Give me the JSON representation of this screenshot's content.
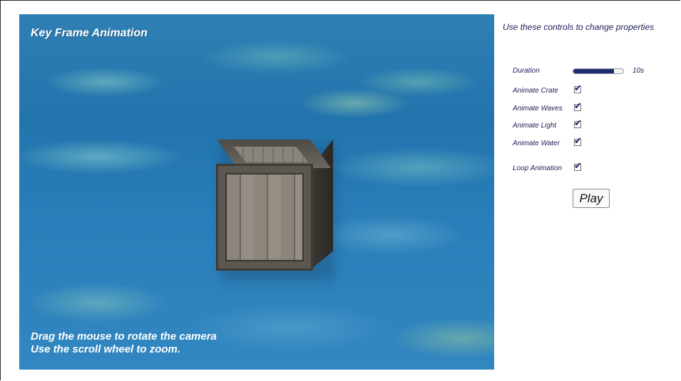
{
  "scene": {
    "title": "Key Frame Animation",
    "help_line_1": "Drag the mouse to rotate the camera",
    "help_line_2": "Use the scroll wheel to zoom."
  },
  "controls": {
    "heading": "Use these controls to change properties",
    "duration": {
      "label": "Duration",
      "value_text": "10s",
      "slider_fraction": 0.82
    },
    "checkboxes": [
      {
        "label": "Animate Crate",
        "checked": true
      },
      {
        "label": "Animate Waves",
        "checked": true
      },
      {
        "label": "Animate Light",
        "checked": true
      },
      {
        "label": "Animate Water",
        "checked": true
      },
      {
        "label": "Loop Animation",
        "checked": true
      }
    ],
    "play_label": "Play"
  },
  "colors": {
    "text_color": "#1d1d5a",
    "slider_fill": "#1b2d6b"
  }
}
